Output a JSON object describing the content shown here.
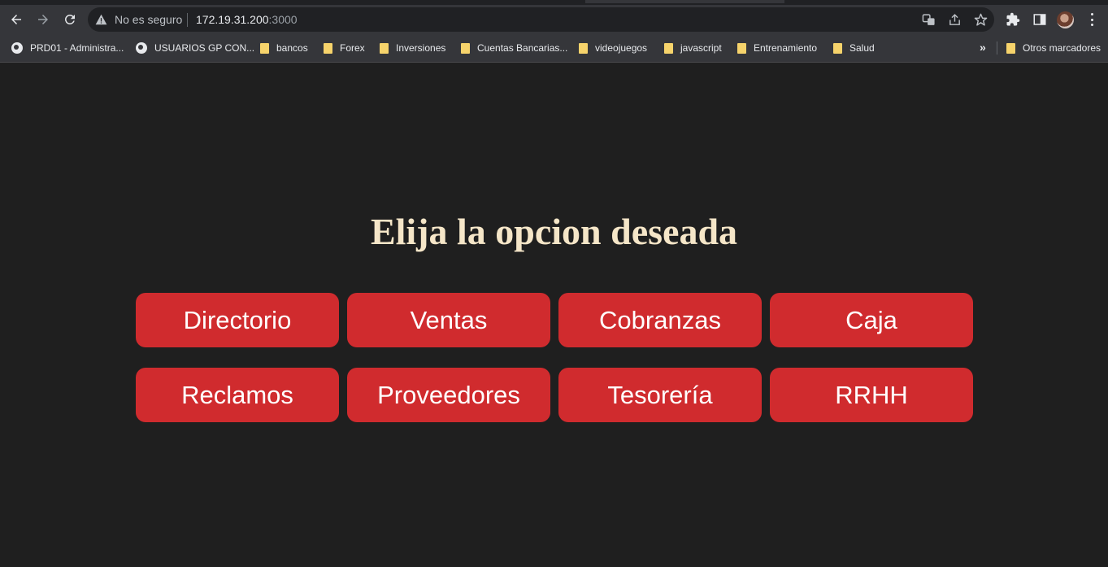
{
  "browser": {
    "security_label": "No es seguro",
    "url_host": "172.19.31.200",
    "url_port": ":3000",
    "icons": [
      "back-icon",
      "forward-icon",
      "reload-icon",
      "warning-icon",
      "translate-icon",
      "share-icon",
      "star-icon",
      "extensions-icon",
      "sidepanel-icon",
      "profile-avatar",
      "menu-icon"
    ]
  },
  "bookmarks": {
    "items": [
      {
        "label": "PRD01 - Administra...",
        "icon": "globe-icon"
      },
      {
        "label": "USUARIOS GP CON...",
        "icon": "globe-icon"
      },
      {
        "label": "bancos",
        "icon": "folder-icon"
      },
      {
        "label": "Forex",
        "icon": "folder-icon"
      },
      {
        "label": "Inversiones",
        "icon": "folder-icon"
      },
      {
        "label": "Cuentas Bancarias...",
        "icon": "folder-icon"
      },
      {
        "label": "videojuegos",
        "icon": "folder-icon"
      },
      {
        "label": "javascript",
        "icon": "folder-icon"
      },
      {
        "label": "Entrenamiento",
        "icon": "folder-icon"
      },
      {
        "label": "Salud",
        "icon": "folder-icon"
      }
    ],
    "overflow": "»",
    "other": "Otros marcadores"
  },
  "page": {
    "title": "Elija la opcion deseada",
    "options": [
      {
        "label": "Directorio"
      },
      {
        "label": "Ventas"
      },
      {
        "label": "Cobranzas"
      },
      {
        "label": "Caja"
      },
      {
        "label": "Reclamos"
      },
      {
        "label": "Proveedores"
      },
      {
        "label": "Tesorería"
      },
      {
        "label": "RRHH"
      }
    ]
  },
  "colors": {
    "background": "#1f1f1f",
    "title": "#f5e6c8",
    "button": "#d02b2e",
    "button_text": "#ffffff"
  }
}
